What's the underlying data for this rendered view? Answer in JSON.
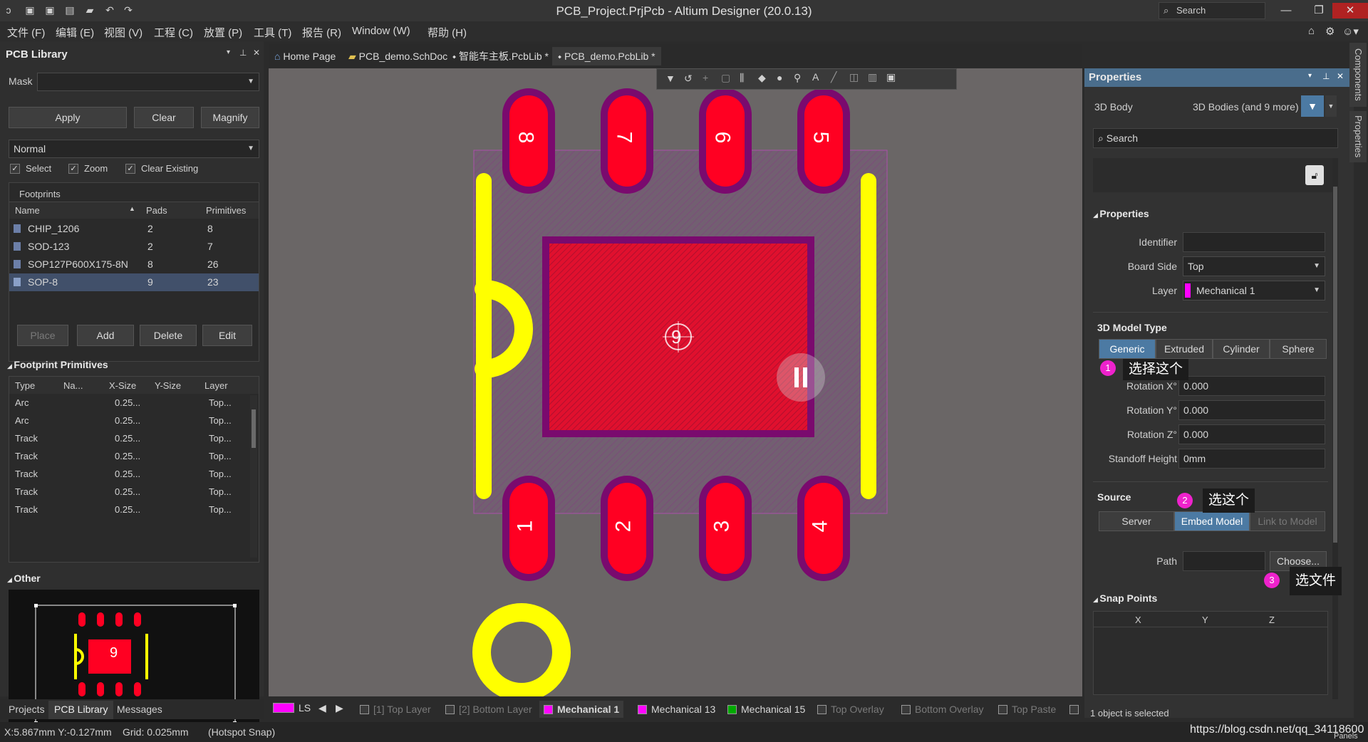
{
  "window": {
    "title": "PCB_Project.PrjPcb - Altium Designer (20.0.13)",
    "search_placeholder": "Search"
  },
  "menu": [
    "文件 (F)",
    "编辑 (E)",
    "视图 (V)",
    "工程 (C)",
    "放置 (P)",
    "工具 (T)",
    "报告 (R)",
    "Window (W)",
    "帮助 (H)"
  ],
  "doc_tabs": [
    {
      "label": "Home Page"
    },
    {
      "label": "PCB_demo.SchDoc"
    },
    {
      "label": "智能车主板.PcbLib *"
    },
    {
      "label": "PCB_demo.PcbLib *"
    }
  ],
  "left_panel": {
    "title": "PCB Library",
    "mask_label": "Mask",
    "mask_value": "",
    "buttons": {
      "apply": "Apply",
      "clear": "Clear",
      "magnify": "Magnify"
    },
    "mode": "Normal",
    "checks": {
      "select": "Select",
      "zoom": "Zoom",
      "clear_existing": "Clear Existing"
    },
    "footprints_label": "Footprints",
    "footprint_cols": {
      "name": "Name",
      "pads": "Pads",
      "primitives": "Primitives"
    },
    "footprints": [
      {
        "name": "CHIP_1206",
        "pads": "2",
        "primitives": "8"
      },
      {
        "name": "SOD-123",
        "pads": "2",
        "primitives": "7"
      },
      {
        "name": "SOP127P600X175-8N",
        "pads": "8",
        "primitives": "26"
      },
      {
        "name": "SOP-8",
        "pads": "9",
        "primitives": "23"
      }
    ],
    "action_buttons": {
      "place": "Place",
      "add": "Add",
      "delete": "Delete",
      "edit": "Edit"
    },
    "primitives_title": "Footprint Primitives",
    "primitive_cols": {
      "type": "Type",
      "name": "Na...",
      "xsize": "X-Size",
      "ysize": "Y-Size",
      "layer": "Layer"
    },
    "primitives": [
      {
        "type": "Arc",
        "xsize": "0.25...",
        "layer": "Top..."
      },
      {
        "type": "Arc",
        "xsize": "0.25...",
        "layer": "Top..."
      },
      {
        "type": "Track",
        "xsize": "0.25...",
        "layer": "Top..."
      },
      {
        "type": "Track",
        "xsize": "0.25...",
        "layer": "Top..."
      },
      {
        "type": "Track",
        "xsize": "0.25...",
        "layer": "Top..."
      },
      {
        "type": "Track",
        "xsize": "0.25...",
        "layer": "Top..."
      },
      {
        "type": "Track",
        "xsize": "0.25...",
        "layer": "Top..."
      }
    ],
    "other_title": "Other",
    "preview_pad_label": "9"
  },
  "bottom_tabs": [
    "Projects",
    "PCB Library",
    "Messages"
  ],
  "canvas": {
    "pads_top": [
      "8",
      "7",
      "6",
      "5"
    ],
    "pads_bottom": [
      "1",
      "2",
      "3",
      "4"
    ],
    "center_pad": "9",
    "colors": {
      "pad": "#ff0022",
      "mask": "#7a0a6e",
      "overlay": "#ffff00",
      "background": "#6a6666"
    }
  },
  "properties": {
    "title": "Properties",
    "object_type": "3D Body",
    "filter_label": "3D Bodies (and 9 more)",
    "search_placeholder": "Search",
    "section_properties": "Properties",
    "identifier_label": "Identifier",
    "identifier_value": "",
    "board_side_label": "Board Side",
    "board_side_value": "Top",
    "layer_label": "Layer",
    "layer_value": "Mechanical 1",
    "model_type_title": "3D Model Type",
    "model_types": [
      "Generic",
      "Extruded",
      "Cylinder",
      "Sphere"
    ],
    "rotation_x_label": "Rotation X°",
    "rotation_x": "0.000",
    "rotation_y_label": "Rotation Y°",
    "rotation_y": "0.000",
    "rotation_z_label": "Rotation Z°",
    "rotation_z": "0.000",
    "standoff_label": "Standoff Height",
    "standoff_value": "0mm",
    "source_title": "Source",
    "source_options": [
      "Server",
      "Embed Model",
      "Link to Model"
    ],
    "path_label": "Path",
    "path_value": "",
    "choose_button": "Choose...",
    "snap_title": "Snap Points",
    "snap_cols": [
      "X",
      "Y",
      "Z"
    ],
    "status": "1 object is selected"
  },
  "callouts": [
    {
      "num": "1",
      "text": "选择这个"
    },
    {
      "num": "2",
      "text": "选这个"
    },
    {
      "num": "3",
      "text": "选文件"
    }
  ],
  "side_tabs": [
    "Components",
    "Properties"
  ],
  "layers": [
    {
      "label": "LS",
      "color": "#ff00ff"
    },
    {
      "label": "[1] Top Layer",
      "dim": true
    },
    {
      "label": "[2] Bottom Layer",
      "dim": true
    },
    {
      "label": "Mechanical 1",
      "color": "#ff00ff",
      "active": true
    },
    {
      "label": "Mechanical 13",
      "color": "#ff00ff"
    },
    {
      "label": "Mechanical 15",
      "color": "#00aa00"
    },
    {
      "label": "Top Overlay",
      "dim": true
    },
    {
      "label": "Bottom Overlay",
      "dim": true
    },
    {
      "label": "Top Paste",
      "dim": true
    }
  ],
  "statusbar": {
    "coords": "X:5.867mm Y:-0.127mm",
    "grid": "Grid: 0.025mm",
    "snap": "(Hotspot Snap)",
    "watermark": "https://blog.csdn.net/qq_34118600",
    "panels": "Panels"
  }
}
